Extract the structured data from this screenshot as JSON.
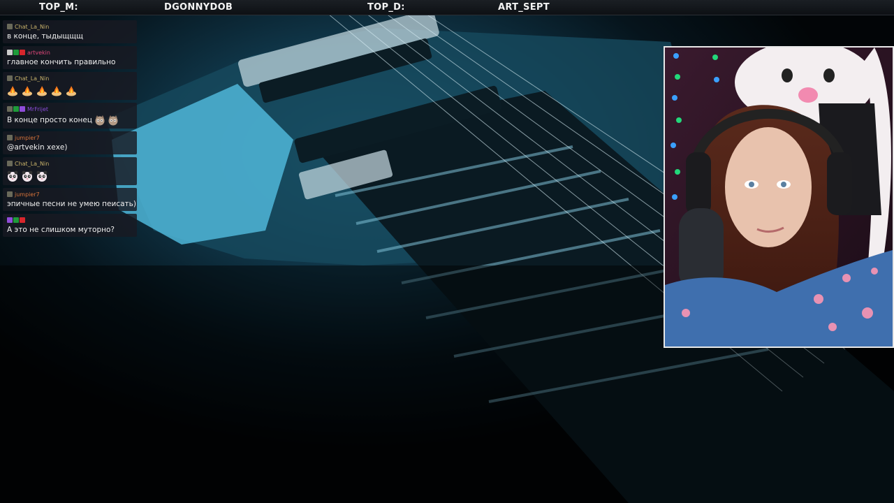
{
  "top_bar": {
    "top_m_label": "TOP_M:",
    "top_m_value": "DGONNYDOB",
    "top_d_label": "TOP_D:",
    "top_d_value": "ART_SEPT"
  },
  "chat": {
    "messages": [
      {
        "user": "Chat_La_Nin",
        "user_color": "#c8b26a",
        "text": "в конце, тыдыщщщ"
      },
      {
        "user": "artvekin",
        "user_color": "#e0477a",
        "text": "главное кончить правильно"
      },
      {
        "user": "Chat_La_Nin",
        "user_color": "#c8b26a",
        "emote_count": 5,
        "emote_icon": "fire-emote"
      },
      {
        "user": "MrFrijet",
        "user_color": "#8a4cd8",
        "text": "В конце просто конец",
        "emote_icon": "cat-emote"
      },
      {
        "user": "jumpier7",
        "user_color": "#d6733a",
        "text": "@artvekin хехе)"
      },
      {
        "user": "Chat_La_Nin",
        "user_color": "#c8b26a",
        "emote_count": 3,
        "emote_icon": "panda-emote"
      },
      {
        "user": "jumpier7",
        "user_color": "#d6733a",
        "text": "эпичные песни не умею пеисать)"
      },
      {
        "user": "",
        "user_color": "#3a5cc8",
        "text": "А это не слишком муторно?"
      }
    ]
  },
  "colors": {
    "background_accent": "#1e5f78",
    "chat_panel_bg": "#181a22",
    "cam_border": "#e8e8e8"
  },
  "icons": {
    "badge": "badge-icon",
    "fire_emote": "fire-emote",
    "cat_emote": "cat-emote",
    "panda_emote": "panda-emote"
  }
}
